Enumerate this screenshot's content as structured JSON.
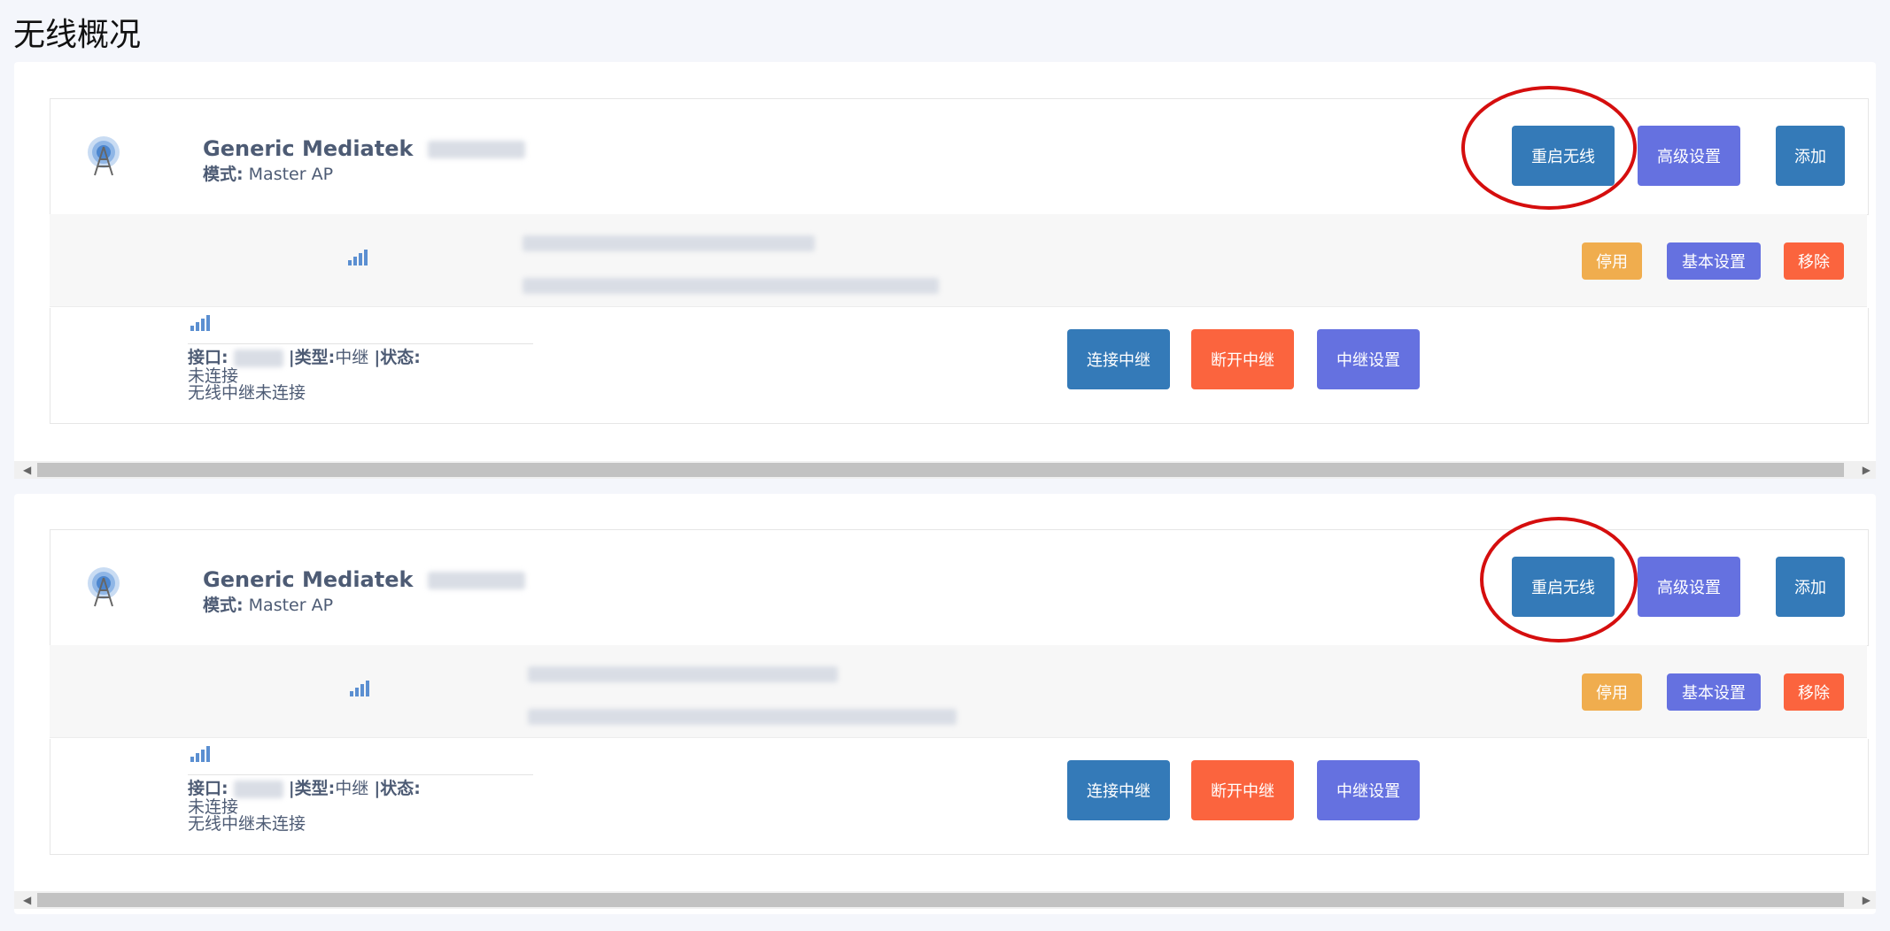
{
  "page": {
    "title": "无线概况"
  },
  "devices": [
    {
      "name": "Generic Mediatek",
      "mode_label": "模式:",
      "mode_value": "Master AP",
      "buttons": {
        "restart": "重启无线",
        "advanced": "高级设置",
        "add": "添加"
      },
      "ssid_buttons": {
        "disable": "停用",
        "basic": "基本设置",
        "remove": "移除"
      },
      "repeater": {
        "interface_label": "接口:",
        "type_label": "|类型:",
        "type_value": "中继",
        "status_label": "|状态:",
        "status_line1": "未连接",
        "status_line2": "无线中继未连接",
        "buttons": {
          "connect": "连接中继",
          "disconnect": "断开中继",
          "settings": "中继设置"
        }
      }
    },
    {
      "name": "Generic Mediatek",
      "mode_label": "模式:",
      "mode_value": "Master AP",
      "buttons": {
        "restart": "重启无线",
        "advanced": "高级设置",
        "add": "添加"
      },
      "ssid_buttons": {
        "disable": "停用",
        "basic": "基本设置",
        "remove": "移除"
      },
      "repeater": {
        "interface_label": "接口:",
        "type_label": "|类型:",
        "type_value": "中继",
        "status_label": "|状态:",
        "status_line1": "未连接",
        "status_line2": "无线中继未连接",
        "buttons": {
          "connect": "连接中继",
          "disconnect": "断开中继",
          "settings": "中继设置"
        }
      }
    }
  ],
  "colors": {
    "blue": "#347ab8",
    "purple": "#6571e0",
    "orange": "#fb643e",
    "amber": "#f0ad4e",
    "highlight": "#d50e0e"
  },
  "icons": {
    "device": "wireless-tower-icon",
    "signal": "signal-bars-icon",
    "scroll_left": "scroll-left-arrow-icon",
    "scroll_right": "scroll-right-arrow-icon"
  }
}
